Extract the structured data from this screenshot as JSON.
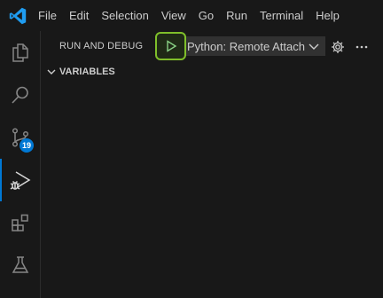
{
  "menu": {
    "items": [
      {
        "label": "File"
      },
      {
        "label": "Edit"
      },
      {
        "label": "Selection"
      },
      {
        "label": "View"
      },
      {
        "label": "Go"
      },
      {
        "label": "Run"
      },
      {
        "label": "Terminal"
      },
      {
        "label": "Help"
      }
    ]
  },
  "activity_bar": {
    "items": [
      {
        "name": "explorer",
        "icon": "files-icon"
      },
      {
        "name": "search",
        "icon": "search-icon"
      },
      {
        "name": "source-control",
        "icon": "source-control-icon",
        "badge": "19"
      },
      {
        "name": "run-and-debug",
        "icon": "run-debug-icon",
        "active": true
      },
      {
        "name": "extensions",
        "icon": "extensions-icon"
      },
      {
        "name": "testing",
        "icon": "flask-icon"
      }
    ]
  },
  "panel": {
    "title": "RUN AND DEBUG",
    "run_button_icon": "play-icon",
    "configuration": {
      "value": "Python: Remote Attach"
    },
    "settings_icon": "gear-icon",
    "more_icon": "ellipsis-icon"
  },
  "sections": {
    "variables": {
      "title": "VARIABLES",
      "expanded": true
    }
  },
  "colors": {
    "background": "#181818",
    "accent": "#0078d4",
    "highlight": "#7fbf2a",
    "text": "#cccccc"
  }
}
